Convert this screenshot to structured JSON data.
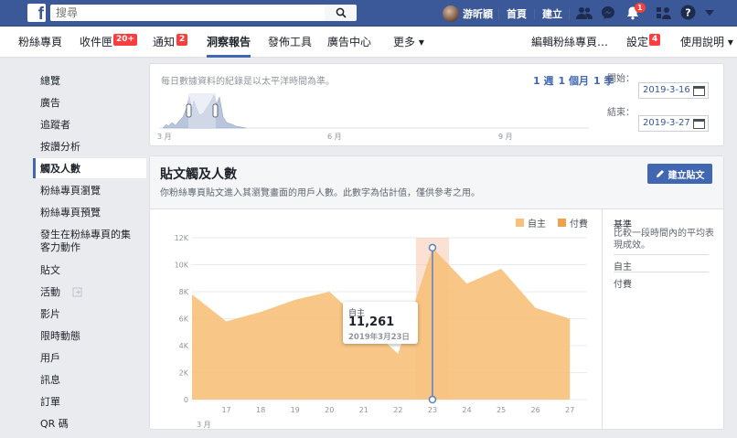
{
  "topbar": {
    "search_placeholder": "搜尋",
    "user_name": "游昕穎",
    "home": "首頁",
    "create": "建立",
    "notifications_count": "1"
  },
  "pagenav": {
    "items": [
      {
        "label": "粉絲專頁"
      },
      {
        "label": "收件匣",
        "badge": "20+"
      },
      {
        "label": "通知",
        "badge": "2"
      },
      {
        "label": "洞察報告"
      },
      {
        "label": "發佈工具"
      },
      {
        "label": "廣告中心"
      },
      {
        "label": "更多 ▾"
      }
    ],
    "edit_info": "編輯粉絲專頁…",
    "settings": "設定",
    "settings_badge": "4",
    "help": "使用說明 ▾"
  },
  "sidebar": {
    "items": [
      {
        "label": "總覽"
      },
      {
        "label": "廣告"
      },
      {
        "label": "追蹤者"
      },
      {
        "label": "按讚分析"
      },
      {
        "label": "觸及人數"
      },
      {
        "label": "粉絲專頁瀏覽"
      },
      {
        "label": "粉絲專頁預覽"
      },
      {
        "label": "發生在粉絲專頁的集"
      },
      {
        "label": "客力動作"
      },
      {
        "label": "貼文"
      },
      {
        "label": "活動"
      },
      {
        "label": "影片"
      },
      {
        "label": "限時動態"
      },
      {
        "label": "用戶"
      },
      {
        "label": "訊息"
      },
      {
        "label": "訂單"
      },
      {
        "label": "QR 碼"
      }
    ]
  },
  "range_panel": {
    "note": "每日數據資料的紀錄是以太平洋時間為準。",
    "range_week": "1 週",
    "range_month": "1 個月",
    "range_quarter": "1 季",
    "start_label": "開始：",
    "start_value": "2019-3-16",
    "end_label": "結束：",
    "end_value": "2019-3-27",
    "mini_months": [
      "3 月",
      "6 月",
      "9 月"
    ]
  },
  "reach_panel": {
    "title": "貼文觸及人數",
    "subtitle": "你粉絲專頁貼文進入其瀏覽畫面的用戶人數。此數字為估計值，僅供參考之用。",
    "create_post": "建立貼文",
    "legend_organic": "自主",
    "legend_paid": "付費",
    "benchmark_title": "基準",
    "benchmark_desc": "比較一段時間內的平均表現成效。",
    "benchmark_organic": "自主",
    "benchmark_paid": "付費"
  },
  "tooltip": {
    "label": "自主",
    "value": "11,261",
    "date": "2019年3月23日"
  },
  "colors": {
    "organic": "#f7c17a",
    "paid": "#f0a150",
    "brand": "#3b5998",
    "accent": "#4267b2"
  },
  "chart_data": {
    "type": "area",
    "x": [
      "16",
      "17",
      "18",
      "19",
      "20",
      "21",
      "22",
      "23",
      "24",
      "25",
      "26",
      "27"
    ],
    "xticks": [
      "17",
      "18",
      "19",
      "20",
      "21",
      "22",
      "23",
      "24",
      "25",
      "26",
      "27"
    ],
    "x_month_label": "3 月",
    "series": [
      {
        "name": "自主",
        "values": [
          7800,
          5800,
          6500,
          7400,
          8000,
          3400,
          11261,
          8600,
          9700,
          6800,
          6000
        ],
        "x": [
          "16",
          "17",
          "18",
          "19",
          "20",
          "22",
          "23",
          "24",
          "25",
          "26",
          "27"
        ]
      },
      {
        "name": "付費",
        "values": [
          0,
          0,
          0,
          0,
          0,
          0,
          0,
          0,
          0,
          0,
          0,
          0
        ]
      }
    ],
    "yticks": [
      "0",
      "2K",
      "4K",
      "6K",
      "8K",
      "10K",
      "12K"
    ],
    "ylim": [
      0,
      12000
    ],
    "highlight_x": "23"
  }
}
